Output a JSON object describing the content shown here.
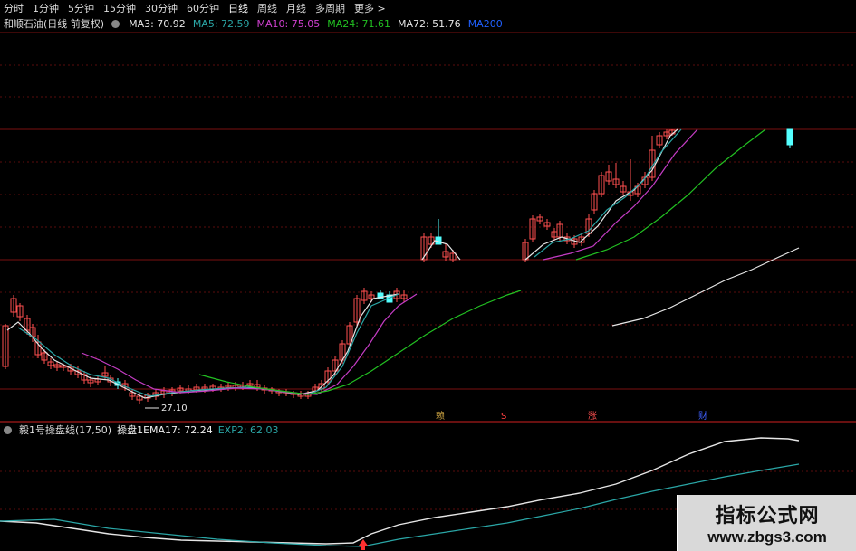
{
  "toolbar": {
    "tabs": [
      "分时",
      "1分钟",
      "5分钟",
      "15分钟",
      "30分钟",
      "60分钟",
      "日线",
      "周线",
      "月线",
      "多周期",
      "更多 >"
    ],
    "active_tab": "日线"
  },
  "main_chart": {
    "stock_title": "和顺石油(日线 前复权)",
    "ma": [
      {
        "label": "MA3: 70.92",
        "color": "#e6e6e6"
      },
      {
        "label": "MA5: 72.59",
        "color": "#2aa6a6"
      },
      {
        "label": "MA10: 75.05",
        "color": "#c43cc4"
      },
      {
        "label": "MA24: 71.61",
        "color": "#22c022"
      },
      {
        "label": "MA72: 51.76",
        "color": "#e6e6e6"
      },
      {
        "label": "MA200",
        "color": "#2060ff"
      }
    ],
    "low_price_label": "27.10",
    "marker_labels": [
      "赖",
      "S",
      "涨",
      "财"
    ]
  },
  "indicator": {
    "title": "毅1号操盘线(17,50)",
    "line1": "操盘1EMA17: 72.24",
    "line2": "EXP2: 62.03",
    "line1_color": "#e6e6e6",
    "line2_color": "#2aa6a6"
  },
  "watermark": {
    "title": "指标公式网",
    "url": "www.zbgs3.com"
  },
  "colors": {
    "up": "#ff5050",
    "down": "#54ffff",
    "grid": "#7a1010",
    "background": "#000000"
  }
}
